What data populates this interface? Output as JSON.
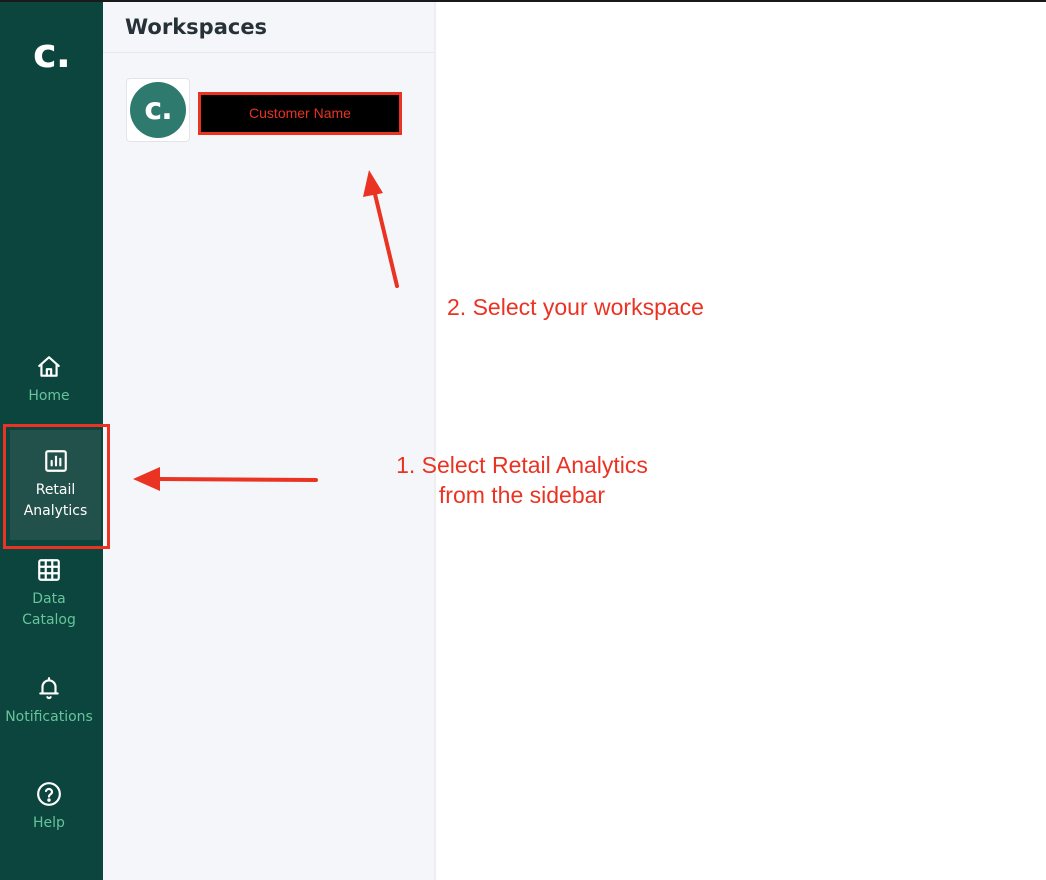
{
  "sidebar": {
    "logo": "c.",
    "items": [
      {
        "label": "Home",
        "icon": "home-icon"
      },
      {
        "label": "Retail\nAnalytics",
        "icon": "bar-chart-icon",
        "active": true
      },
      {
        "label": "Data\nCatalog",
        "icon": "grid-icon"
      },
      {
        "label": "Notifications",
        "icon": "bell-icon"
      },
      {
        "label": "Help",
        "icon": "help-circle-icon"
      }
    ]
  },
  "workspaces": {
    "title": "Workspaces",
    "items": [
      {
        "avatar_text": "c.",
        "name": "Customer Name"
      }
    ]
  },
  "annotations": {
    "step1": "1. Select Retail Analytics\nfrom the sidebar",
    "step2": "2. Select your workspace"
  },
  "colors": {
    "sidebar_bg": "#0b453e",
    "sidebar_text": "#67c49a",
    "active_bg": "#21514a",
    "annotation_red": "#ea3323",
    "avatar_bg": "#2f7a6f"
  }
}
